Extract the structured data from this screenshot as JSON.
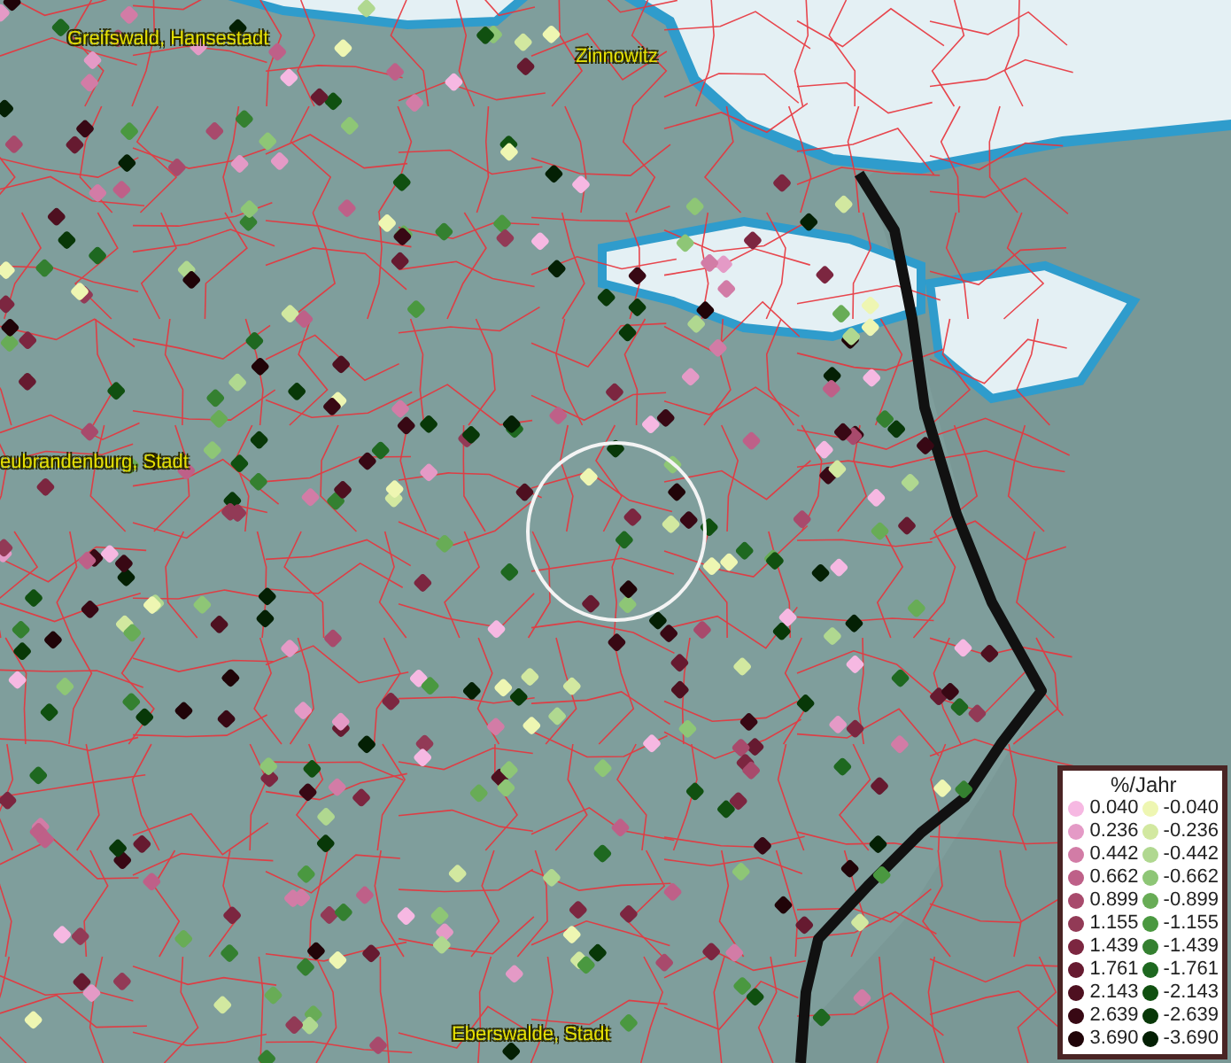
{
  "places": [
    {
      "label": "Greifswald, Hansestadt"
    },
    {
      "label": "Zinnowitz"
    },
    {
      "label": "eubrandenburg, Stadt"
    },
    {
      "label": "Eberswalde, Stadt"
    }
  ],
  "legend": {
    "title": "%/Jahr",
    "positive": [
      {
        "label": "0.040",
        "color": "#f6b8e2"
      },
      {
        "label": "0.236",
        "color": "#e49ac6"
      },
      {
        "label": "0.442",
        "color": "#d27ca6"
      },
      {
        "label": "0.662",
        "color": "#be6088"
      },
      {
        "label": "0.899",
        "color": "#a84a6c"
      },
      {
        "label": "1.155",
        "color": "#923a56"
      },
      {
        "label": "1.439",
        "color": "#7c2640"
      },
      {
        "label": "1.761",
        "color": "#661a30"
      },
      {
        "label": "2.143",
        "color": "#4e1020"
      },
      {
        "label": "2.639",
        "color": "#380814"
      },
      {
        "label": "3.690",
        "color": "#200408"
      }
    ],
    "negative": [
      {
        "label": "-0.040",
        "color": "#eef6b2"
      },
      {
        "label": "-0.236",
        "color": "#d2e8a0"
      },
      {
        "label": "-0.442",
        "color": "#b0d890"
      },
      {
        "label": "-0.662",
        "color": "#8ec676"
      },
      {
        "label": "-0.899",
        "color": "#68ac56"
      },
      {
        "label": "-1.155",
        "color": "#4a9840"
      },
      {
        "label": "-1.439",
        "color": "#348030"
      },
      {
        "label": "-1.761",
        "color": "#1e6820"
      },
      {
        "label": "-2.143",
        "color": "#105010"
      },
      {
        "label": "-2.639",
        "color": "#083808"
      },
      {
        "label": "-3.690",
        "color": "#042004"
      }
    ]
  }
}
